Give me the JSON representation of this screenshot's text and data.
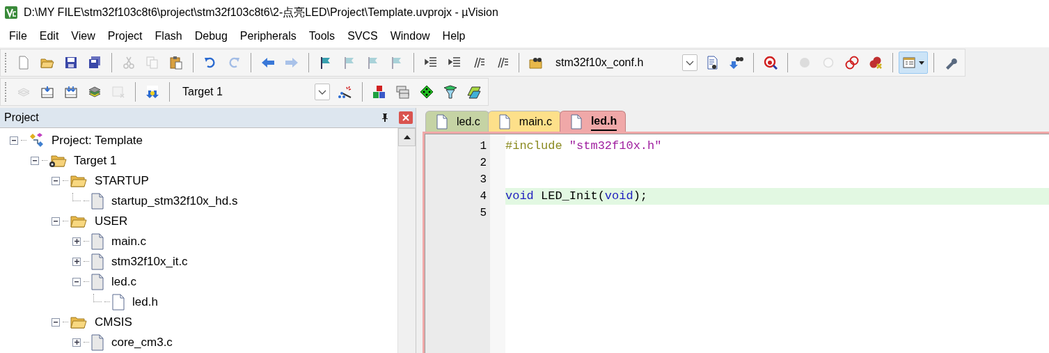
{
  "window": {
    "title": "D:\\MY FILE\\stm32f103c8t6\\project\\stm32f103c8t6\\2-点亮LED\\Project\\Template.uvprojx - µVision"
  },
  "menu": [
    "File",
    "Edit",
    "View",
    "Project",
    "Flash",
    "Debug",
    "Peripherals",
    "Tools",
    "SVCS",
    "Window",
    "Help"
  ],
  "toolbar_1": [
    {
      "kind": "button",
      "disabled": false
    },
    {
      "kind": "button",
      "disabled": false
    },
    {
      "kind": "button",
      "disabled": false
    },
    {
      "kind": "button",
      "disabled": false
    },
    {
      "kind": "separator"
    },
    {
      "kind": "button",
      "disabled": true
    },
    {
      "kind": "button",
      "disabled": true
    },
    {
      "kind": "button",
      "disabled": false
    },
    {
      "kind": "separator"
    },
    {
      "kind": "button",
      "disabled": false
    },
    {
      "kind": "button",
      "disabled": true
    },
    {
      "kind": "separator"
    },
    {
      "kind": "button",
      "disabled": false
    },
    {
      "kind": "button",
      "disabled": true
    },
    {
      "kind": "separator"
    },
    {
      "kind": "button",
      "disabled": false
    },
    {
      "kind": "button",
      "disabled": true
    },
    {
      "kind": "button",
      "disabled": true
    },
    {
      "kind": "button",
      "disabled": true
    },
    {
      "kind": "separator"
    },
    {
      "kind": "button",
      "disabled": false
    },
    {
      "kind": "button",
      "disabled": false
    },
    {
      "kind": "button",
      "disabled": false
    },
    {
      "kind": "button",
      "disabled": false
    },
    {
      "kind": "separator"
    },
    {
      "kind": "button",
      "disabled": false
    },
    {
      "kind": "combo",
      "value": "stm32f10x_conf.h"
    },
    {
      "kind": "button",
      "disabled": false
    },
    {
      "kind": "button",
      "disabled": false
    },
    {
      "kind": "separator"
    },
    {
      "kind": "button",
      "disabled": false
    },
    {
      "kind": "separator"
    },
    {
      "kind": "button",
      "disabled": true
    },
    {
      "kind": "button",
      "disabled": true
    },
    {
      "kind": "button",
      "disabled": false
    },
    {
      "kind": "button",
      "disabled": false
    },
    {
      "kind": "separator"
    },
    {
      "kind": "dropdown_button",
      "selected": true
    },
    {
      "kind": "separator"
    },
    {
      "kind": "button",
      "disabled": false
    }
  ],
  "toolbar_2": [
    {
      "kind": "button",
      "disabled": true
    },
    {
      "kind": "button",
      "disabled": false
    },
    {
      "kind": "button",
      "disabled": false
    },
    {
      "kind": "button",
      "disabled": false
    },
    {
      "kind": "button",
      "disabled": true
    },
    {
      "kind": "separator"
    },
    {
      "kind": "button",
      "disabled": false
    },
    {
      "kind": "separator"
    },
    {
      "kind": "combo",
      "value": "Target 1"
    },
    {
      "kind": "button",
      "disabled": false
    },
    {
      "kind": "separator"
    },
    {
      "kind": "button",
      "disabled": false
    },
    {
      "kind": "button",
      "disabled": false
    },
    {
      "kind": "button",
      "disabled": false
    },
    {
      "kind": "button",
      "disabled": false
    },
    {
      "kind": "button",
      "disabled": false
    }
  ],
  "project_panel": {
    "title": "Project",
    "tree": [
      {
        "kind": "project",
        "label": "Project: Template",
        "expanded": true,
        "children": [
          {
            "kind": "target",
            "label": "Target 1",
            "expanded": true,
            "children": [
              {
                "kind": "folder",
                "label": "STARTUP",
                "expanded": true,
                "children": [
                  {
                    "kind": "file",
                    "label": "startup_stm32f10x_hd.s"
                  }
                ]
              },
              {
                "kind": "folder",
                "label": "USER",
                "expanded": true,
                "children": [
                  {
                    "kind": "file",
                    "label": "main.c",
                    "expanded": false
                  },
                  {
                    "kind": "file",
                    "label": "stm32f10x_it.c",
                    "expanded": false
                  },
                  {
                    "kind": "file",
                    "label": "led.c",
                    "expanded": true,
                    "children": [
                      {
                        "kind": "header",
                        "label": "led.h"
                      }
                    ]
                  }
                ]
              },
              {
                "kind": "folder",
                "label": "CMSIS",
                "expanded": true,
                "children": [
                  {
                    "kind": "file",
                    "label": "core_cm3.c",
                    "expanded": false
                  }
                ]
              }
            ]
          }
        ]
      }
    ]
  },
  "editor": {
    "tabs": [
      {
        "label": "led.c",
        "color": "#c5d3a4",
        "selected": false
      },
      {
        "label": "main.c",
        "color": "#fde08a",
        "selected": false
      },
      {
        "label": "led.h",
        "color": "#f0a8a8",
        "selected": true
      }
    ],
    "lines": [
      {
        "number": "1",
        "tokens": [
          {
            "kind": "preprocessor",
            "text": "#include"
          },
          {
            "kind": "string",
            "text": " \"stm32f10x.h\""
          }
        ]
      },
      {
        "number": "2"
      },
      {
        "number": "3"
      },
      {
        "number": "4",
        "current": true,
        "tokens": [
          {
            "kind": "keyword",
            "text": "void"
          },
          {
            "kind": "plain",
            "text": " LED_Init("
          },
          {
            "kind": "keyword",
            "text": "void"
          },
          {
            "kind": "plain",
            "text": ");"
          }
        ]
      },
      {
        "number": "5"
      }
    ]
  }
}
